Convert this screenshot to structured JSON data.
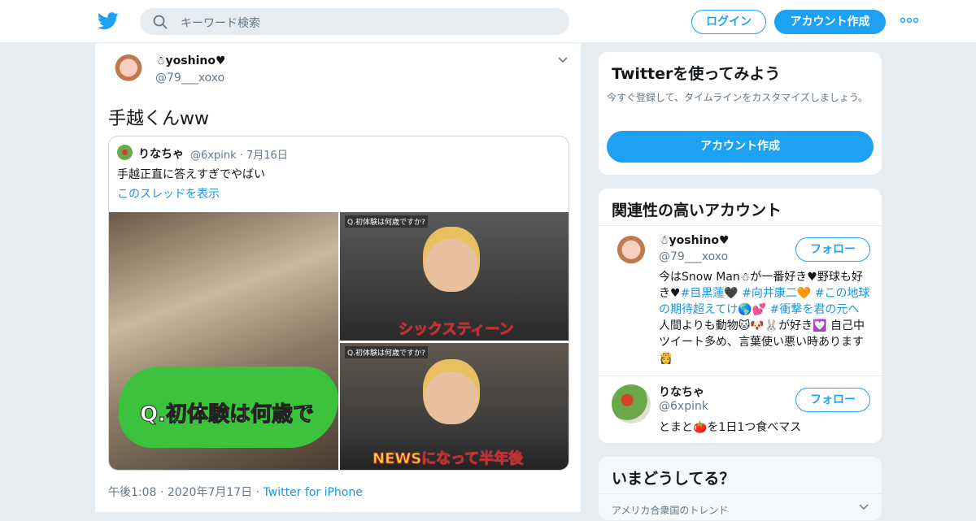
{
  "header": {
    "search_placeholder": "キーワード検索",
    "login_label": "ログイン",
    "signup_label": "アカウント作成"
  },
  "tweet": {
    "name": "☃yoshino♥",
    "handle": "@79___xoxo",
    "text": "手越くんww",
    "quote": {
      "name": "りなちゃ",
      "handle": "@6xpink",
      "date": "7月16日",
      "text": "手越正直に答えすぎでやばい",
      "thread_link": "このスレッドを表示",
      "media_captions": [
        "Q.初体験は何歳で",
        "シックスティーン",
        "NEWSになって半年後"
      ],
      "media_question": "Q.初体験は何歳ですか?"
    },
    "time": "午後1:08",
    "date": "2020年7月17日",
    "source": "Twitter for iPhone"
  },
  "sidebar": {
    "signup_card": {
      "title": "Twitterを使ってみよう",
      "subtitle": "今すぐ登録して、タイムラインをカスタマイズしましょう。",
      "button": "アカウント作成"
    },
    "related": {
      "title": "関連性の高いアカウント",
      "follow_label": "フォロー",
      "accounts": [
        {
          "name": "☃yoshino♥",
          "handle": "@79___xoxo",
          "bio_a": "今はSnow Man☃が一番好き♥野球も好き♥",
          "tag1": "#目黒蓮",
          "mid1": "🖤",
          "tag2": "#向井康二",
          "mid2": "🧡",
          "tag3": "#この地球の期待超えてけ",
          "mid3": "🌎💕",
          "tag4": "#衝撃を君の元へ",
          "bio_b": " 人間よりも動物🐱🐶🐰が好き💟 自己中ツイート多め、言葉使い悪い時あります👸"
        },
        {
          "name": "りなちゃ",
          "handle": "@6xpink",
          "bio": "とまと🍅を1日1つ食べマス"
        }
      ]
    },
    "trends": {
      "title": "いまどうしてる？",
      "location": "アメリカ合衆国のトレンド"
    }
  },
  "colors": {
    "brand": "#1da1f2",
    "link": "#1b95e0",
    "muted": "#657786"
  }
}
